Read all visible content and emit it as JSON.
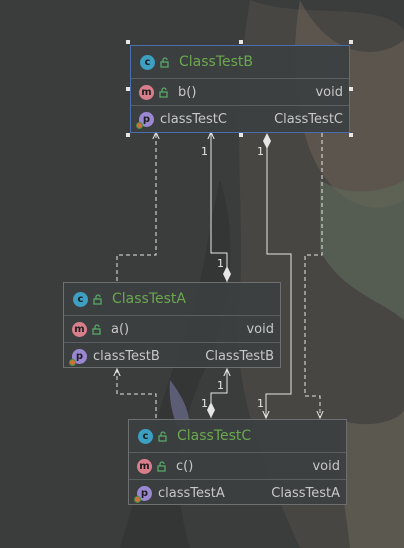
{
  "colors": {
    "class_title": "#6aa84f",
    "node_background": "#3c3f41",
    "node_border": "#6d6f70",
    "selected_border": "#4b6eaf",
    "edge": "#e6e6e6",
    "class_badge": "#3d9fc2",
    "method_badge": "#d97f8c",
    "property_badge": "#9a87d1"
  },
  "badges": {
    "class": "c",
    "method": "m",
    "property": "p"
  },
  "icons": [
    "class-icon",
    "method-icon",
    "property-icon",
    "unlocked-icon"
  ],
  "nodes": {
    "classB": {
      "title": "ClassTestB",
      "method": {
        "name": "b()",
        "type": "void"
      },
      "property": {
        "name": "classTestC",
        "type": "ClassTestC"
      }
    },
    "classA": {
      "title": "ClassTestA",
      "method": {
        "name": "a()",
        "type": "void"
      },
      "property": {
        "name": "classTestB",
        "type": "ClassTestB"
      }
    },
    "classC": {
      "title": "ClassTestC",
      "method": {
        "name": "c()",
        "type": "void"
      },
      "property": {
        "name": "classTestA",
        "type": "ClassTestA"
      }
    }
  },
  "multiplicities": {
    "a_to_b_target": "1",
    "a_to_b_source": "1",
    "b_to_c_source": "1",
    "b_to_c_target": "1",
    "c_to_a_source": "1",
    "c_to_a_target": "1"
  }
}
